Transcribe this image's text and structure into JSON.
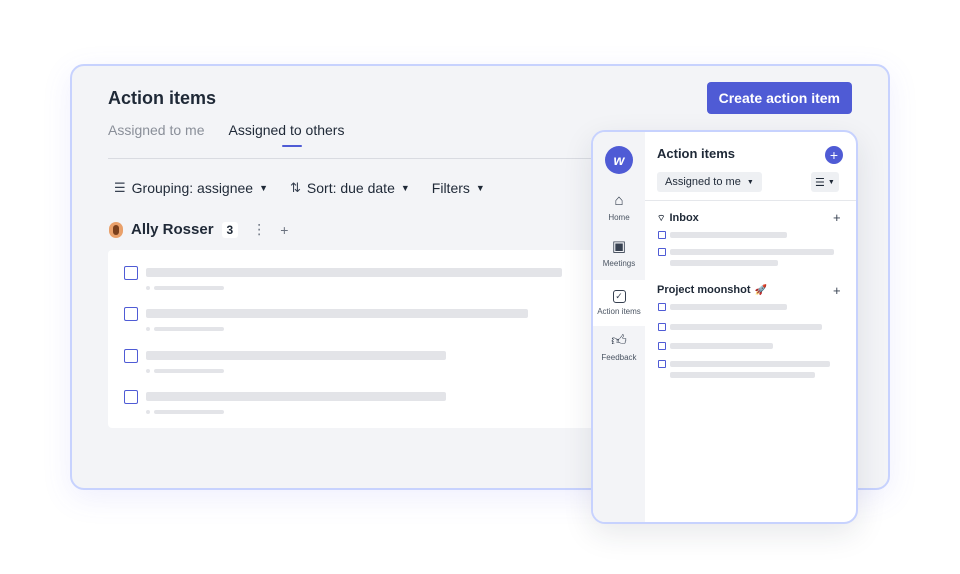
{
  "main": {
    "title": "Action items",
    "create_label": "Create action item",
    "tabs": [
      {
        "label": "Assigned to me",
        "active": false
      },
      {
        "label": "Assigned to others",
        "active": true
      }
    ],
    "toolbar": {
      "grouping_label": "Grouping: assignee",
      "sort_label": "Sort: due date",
      "filters_label": "Filters"
    },
    "group": {
      "assignee": "Ally Rosser",
      "count": "3"
    },
    "accent_color": "#4f5bd5"
  },
  "panel": {
    "logo_letter": "w",
    "title": "Action items",
    "filter_value": "Assigned to me",
    "nav": [
      {
        "label": "Home",
        "icon": "home-icon"
      },
      {
        "label": "Meetings",
        "icon": "calendar-icon"
      },
      {
        "label": "Action items",
        "icon": "checkbox-icon"
      },
      {
        "label": "Feedback",
        "icon": "thumbs-up-icon"
      }
    ],
    "sections": [
      {
        "title": "Inbox",
        "icon": "inbox-icon"
      },
      {
        "title": "Project moonshot",
        "emoji": "🚀"
      }
    ]
  }
}
